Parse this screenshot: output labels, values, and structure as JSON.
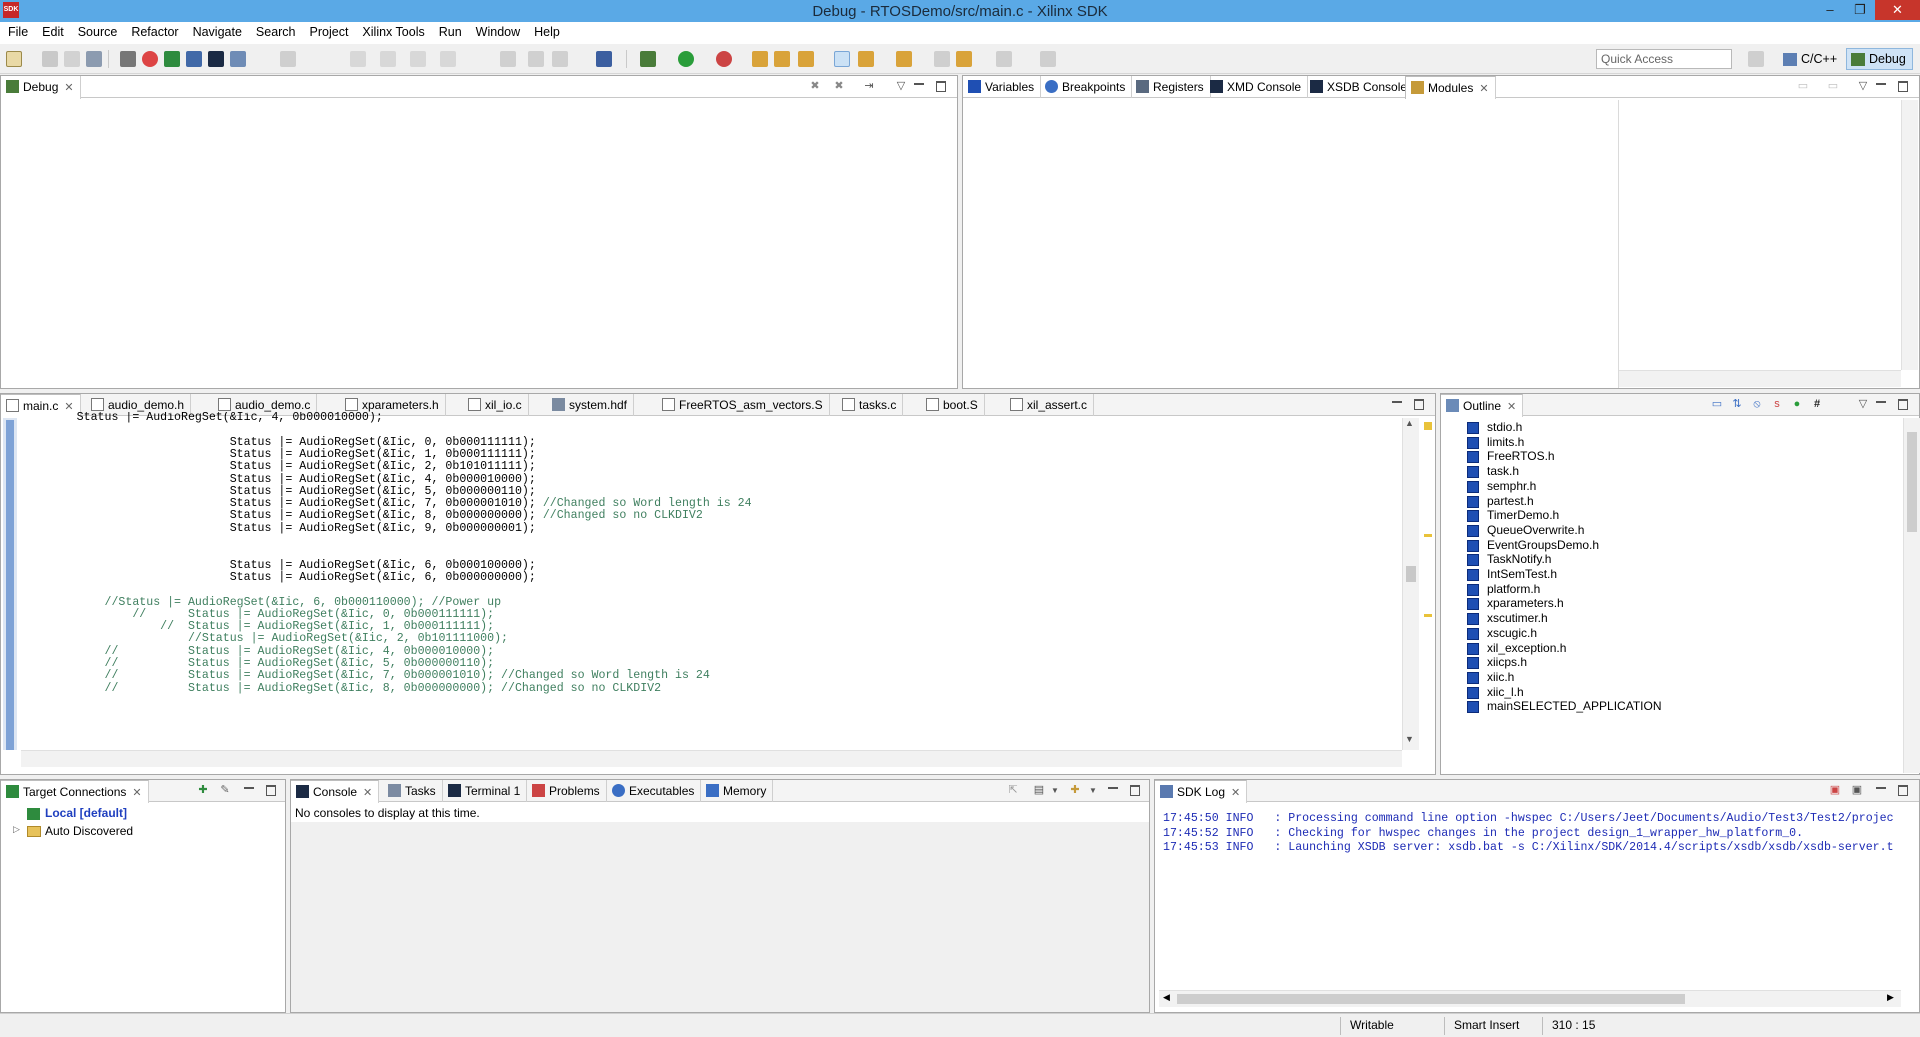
{
  "window": {
    "title": "Debug - RTOSDemo/src/main.c - Xilinx SDK",
    "app_icon": "SDK",
    "minimize": "–",
    "restore": "❐",
    "close": "✕"
  },
  "menu": [
    "File",
    "Edit",
    "Source",
    "Refactor",
    "Navigate",
    "Search",
    "Project",
    "Xilinx Tools",
    "Run",
    "Window",
    "Help"
  ],
  "toolbar": {
    "quick_access_placeholder": "Quick Access",
    "perspectives": [
      {
        "label": "C/C++",
        "icon": "c-cpp-perspective-icon"
      },
      {
        "label": "Debug",
        "icon": "debug-perspective-icon",
        "active": true
      }
    ]
  },
  "debug_view": {
    "tab": "Debug"
  },
  "variables_view": {
    "tabs": [
      "Variables",
      "Breakpoints",
      "Registers",
      "XMD Console",
      "XSDB Console",
      "Modules"
    ]
  },
  "editor": {
    "tabs": [
      "main.c",
      "audio_demo.h",
      "audio_demo.c",
      "xparameters.h",
      "xil_io.c",
      "system.hdf",
      "FreeRTOS_asm_vectors.S",
      "tasks.c",
      "boot.S",
      "xil_assert.c"
    ],
    "lines": [
      {
        "text": "        Status |= AudioRegSet(&Iic, 4, 0b000010000);",
        "comment": ""
      },
      {
        "text": "",
        "comment": ""
      },
      {
        "text": "                              Status |= AudioRegSet(&Iic, 0, 0b000111111);",
        "comment": ""
      },
      {
        "text": "                              Status |= AudioRegSet(&Iic, 1, 0b000111111);",
        "comment": ""
      },
      {
        "text": "                              Status |= AudioRegSet(&Iic, 2, 0b101011111);",
        "comment": ""
      },
      {
        "text": "                              Status |= AudioRegSet(&Iic, 4, 0b000010000);",
        "comment": ""
      },
      {
        "text": "                              Status |= AudioRegSet(&Iic, 5, 0b000000110);",
        "comment": ""
      },
      {
        "text": "                              Status |= AudioRegSet(&Iic, 7, 0b000001010); ",
        "comment": "//Changed so Word length is 24"
      },
      {
        "text": "                              Status |= AudioRegSet(&Iic, 8, 0b000000000); ",
        "comment": "//Changed so no CLKDIV2"
      },
      {
        "text": "                              Status |= AudioRegSet(&Iic, 9, 0b000000001);",
        "comment": ""
      },
      {
        "text": "",
        "comment": ""
      },
      {
        "text": "",
        "comment": ""
      },
      {
        "text": "                              Status |= AudioRegSet(&Iic, 6, 0b000100000);",
        "comment": ""
      },
      {
        "text": "                              Status |= AudioRegSet(&Iic, 6, 0b000000000);",
        "comment": ""
      },
      {
        "text": "",
        "comment": ""
      },
      {
        "text": "",
        "comment": "            //Status |= AudioRegSet(&Iic, 6, 0b000110000); //Power up"
      },
      {
        "text": "",
        "comment": "                //      Status |= AudioRegSet(&Iic, 0, 0b000111111);"
      },
      {
        "text": "",
        "comment": "                    //  Status |= AudioRegSet(&Iic, 1, 0b000111111);"
      },
      {
        "text": "",
        "comment": "                        //Status |= AudioRegSet(&Iic, 2, 0b101111000);"
      },
      {
        "text": "",
        "comment": "            //          Status |= AudioRegSet(&Iic, 4, 0b000010000);"
      },
      {
        "text": "",
        "comment": "            //          Status |= AudioRegSet(&Iic, 5, 0b000000110);"
      },
      {
        "text": "",
        "comment": "            //          Status |= AudioRegSet(&Iic, 7, 0b000001010); //Changed so Word length is 24"
      },
      {
        "text": "",
        "comment": "            //          Status |= AudioRegSet(&Iic, 8, 0b000000000); //Changed so no CLKDIV2"
      }
    ]
  },
  "outline": {
    "tab": "Outline",
    "items": [
      "stdio.h",
      "limits.h",
      "FreeRTOS.h",
      "task.h",
      "semphr.h",
      "partest.h",
      "TimerDemo.h",
      "QueueOverwrite.h",
      "EventGroupsDemo.h",
      "TaskNotify.h",
      "IntSemTest.h",
      "platform.h",
      "xparameters.h",
      "xscutimer.h",
      "xscugic.h",
      "xil_exception.h",
      "xiicps.h",
      "xiic.h",
      "xiic_l.h",
      "mainSELECTED_APPLICATION"
    ]
  },
  "target_connections": {
    "tab": "Target Connections",
    "items": [
      {
        "label": "Local [default]",
        "icon": "local-target-icon"
      },
      {
        "label": "Auto Discovered",
        "icon": "folder-icon"
      }
    ]
  },
  "console": {
    "tabs": [
      "Console",
      "Tasks",
      "Terminal 1",
      "Problems",
      "Executables",
      "Memory"
    ],
    "message": "No consoles to display at this time."
  },
  "sdk_log": {
    "tab": "SDK Log",
    "lines": [
      "17:45:50 INFO   : Processing command line option -hwspec C:/Users/Jeet/Documents/Audio/Test3/Test2/projec",
      "17:45:52 INFO   : Checking for hwspec changes in the project design_1_wrapper_hw_platform_0.",
      "17:45:53 INFO   : Launching XSDB server: xsdb.bat -s C:/Xilinx/SDK/2014.4/scripts/xsdb/xsdb/xsdb-server.t"
    ]
  },
  "status_bar": {
    "writable": "Writable",
    "insert_mode": "Smart Insert",
    "position": "310 : 15"
  },
  "colors": {
    "title_bar": "#5aa9e6",
    "comment": "#3f7f5f",
    "log_text": "#1d2bb5",
    "close_button": "#c7352b"
  }
}
